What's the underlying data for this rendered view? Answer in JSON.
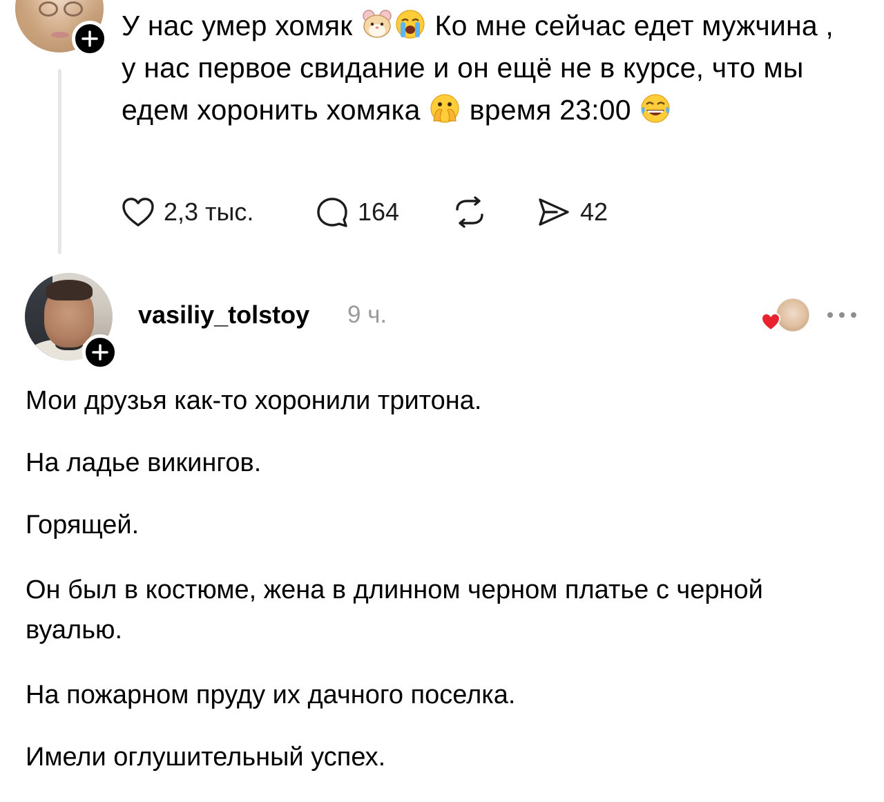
{
  "post": {
    "text_part1": "У нас умер хомяк",
    "text_part2": "Ко мне сейчас едет мужчина , у нас первое свидание и он ещё не в курсе, что мы едем хоронить хомяка",
    "text_part3": "время 23:00",
    "emojis": [
      "hamster-face-emoji",
      "loudly-crying-face-emoji",
      "face-with-open-eyes-and-hand-over-mouth-emoji",
      "face-with-tears-of-joy-emoji"
    ],
    "likes": "2,3 тыс.",
    "comments": "164",
    "shares": "42"
  },
  "reply": {
    "username": "vasiliy_tolstoy",
    "time": "9 ч.",
    "paragraphs": [
      "Мои друзья как-то хоронили тритона.",
      "На ладье викингов.",
      "Горящей.",
      "Он был в костюме, жена в длинном черном платье с черной вуалью.",
      "На пожарном пруду их дачного поселка.",
      "Имели оглушительный успех."
    ]
  },
  "colors": {
    "text": "#000000",
    "muted": "#9a9a9a",
    "heart": "#e8232f",
    "thread_line": "#e6e6e6"
  }
}
